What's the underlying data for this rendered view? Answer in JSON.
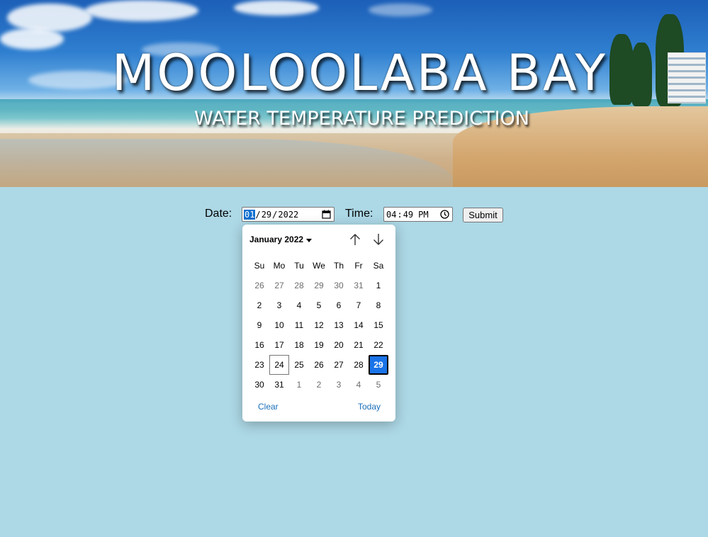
{
  "banner": {
    "title": "MOOLOOLABA BAY",
    "subtitle": "WATER TEMPERATURE PREDICTION"
  },
  "form": {
    "date_label": "Date:",
    "date_value": {
      "month": "01",
      "day": "29",
      "year": "2022",
      "separator": "/"
    },
    "time_label": "Time:",
    "time_value": {
      "hour": "04",
      "minute": "49",
      "period": "PM"
    },
    "submit_label": "Submit"
  },
  "calendar": {
    "month_label": "January 2022",
    "weekdays": [
      "Su",
      "Mo",
      "Tu",
      "We",
      "Th",
      "Fr",
      "Sa"
    ],
    "weeks": [
      [
        "26",
        "27",
        "28",
        "29",
        "30",
        "31",
        "1"
      ],
      [
        "2",
        "3",
        "4",
        "5",
        "6",
        "7",
        "8"
      ],
      [
        "9",
        "10",
        "11",
        "12",
        "13",
        "14",
        "15"
      ],
      [
        "16",
        "17",
        "18",
        "19",
        "20",
        "21",
        "22"
      ],
      [
        "23",
        "24",
        "25",
        "26",
        "27",
        "28",
        "29"
      ],
      [
        "30",
        "31",
        "1",
        "2",
        "3",
        "4",
        "5"
      ]
    ],
    "today_day": "24",
    "selected_day": "29",
    "clear_label": "Clear",
    "today_label": "Today"
  },
  "colors": {
    "page_background": "#add8e6",
    "selected_day": "#1a73e8",
    "link": "#1a6fb8"
  },
  "icons": [
    "calendar-icon",
    "clock-icon",
    "dropdown-caret-icon",
    "arrow-up-icon",
    "arrow-down-icon"
  ]
}
